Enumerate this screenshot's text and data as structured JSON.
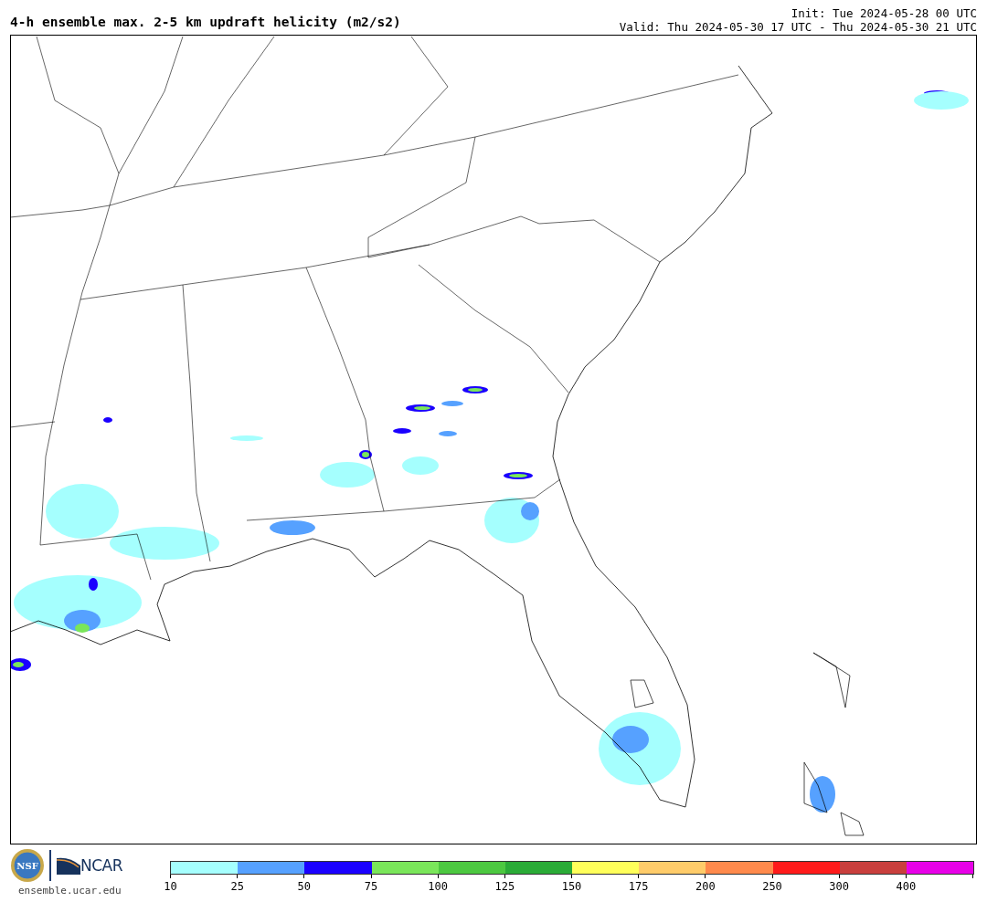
{
  "header": {
    "title": "4-h ensemble max. 2-5 km updraft helicity (m2/s2)",
    "init": "Init: Tue 2024-05-28 00 UTC",
    "valid": "Valid: Thu 2024-05-30 17 UTC - Thu 2024-05-30 21 UTC"
  },
  "footer": {
    "nsf_logo": "NSF",
    "ncar_logo": "NCAR",
    "url": "ensemble.ucar.edu"
  },
  "colorbar": {
    "bins": [
      {
        "color": "#a5fffe"
      },
      {
        "color": "#56a1ff"
      },
      {
        "color": "#1a00ff"
      },
      {
        "color": "#7ae65a"
      },
      {
        "color": "#4cc840"
      },
      {
        "color": "#2aab37"
      },
      {
        "color": "#ffff5a"
      },
      {
        "color": "#ffcc6a"
      },
      {
        "color": "#ff8a4c"
      },
      {
        "color": "#ff1a1a"
      },
      {
        "color": "#c93f3d"
      },
      {
        "color": "#e800e8"
      }
    ],
    "ticks": [
      "10",
      "25",
      "50",
      "75",
      "100",
      "125",
      "150",
      "175",
      "200",
      "250",
      "300",
      "400"
    ]
  }
}
